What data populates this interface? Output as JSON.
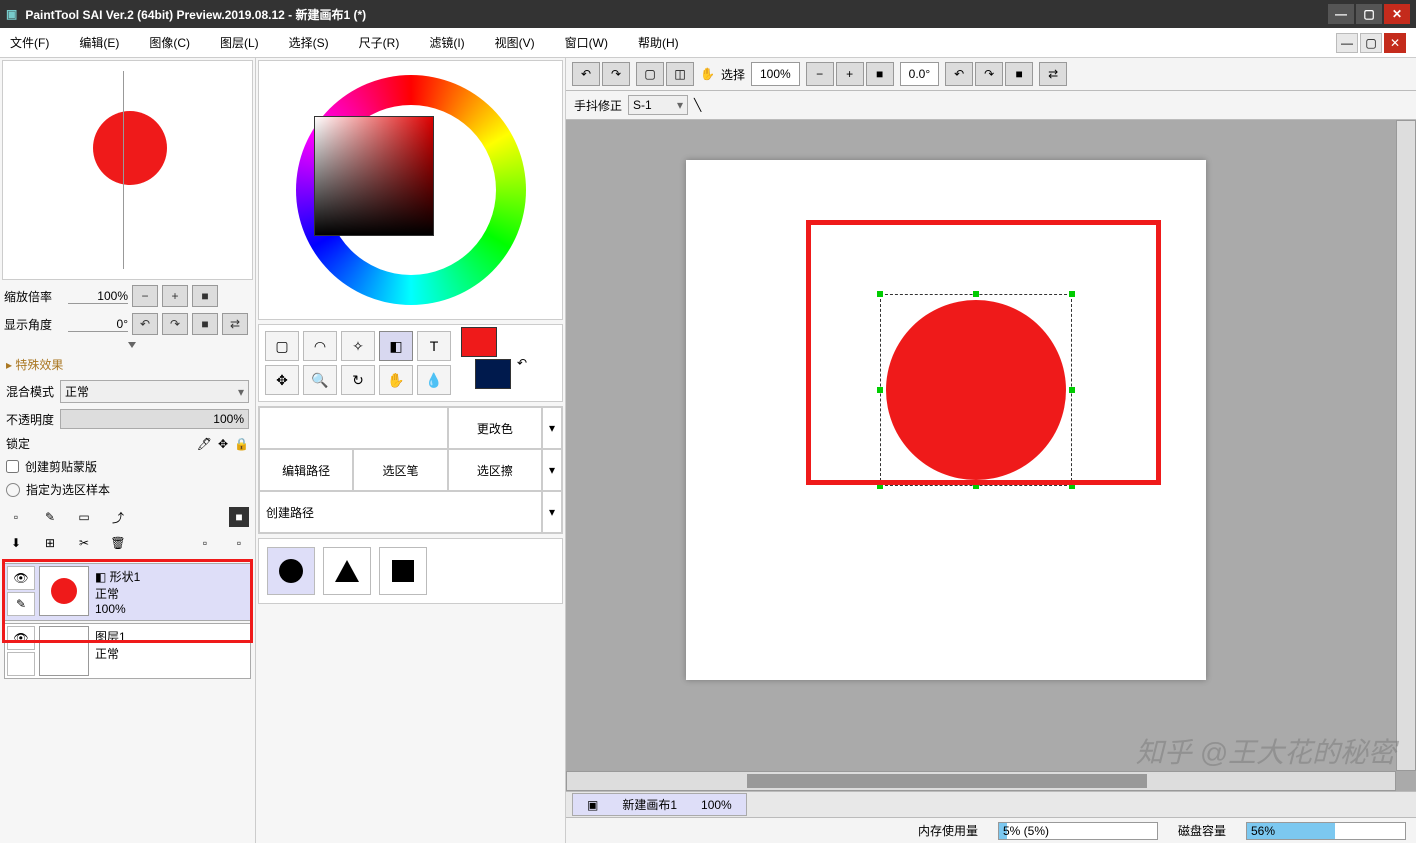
{
  "titlebar": {
    "title": "PaintTool SAI Ver.2 (64bit) Preview.2019.08.12 - 新建画布1 (*)"
  },
  "menu": [
    "文件(F)",
    "编辑(E)",
    "图像(C)",
    "图层(L)",
    "选择(S)",
    "尺子(R)",
    "滤镜(I)",
    "视图(V)",
    "窗口(W)",
    "帮助(H)"
  ],
  "nav": {
    "zoom_label": "缩放倍率",
    "zoom_value": "100%",
    "angle_label": "显示角度",
    "angle_value": "0°"
  },
  "effects_header": "▸ 特殊效果",
  "blend": {
    "label": "混合模式",
    "value": "正常"
  },
  "opacity": {
    "label": "不透明度",
    "value": "100%"
  },
  "lock_label": "锁定",
  "clipping_label": "创建剪贴蒙版",
  "select_sample_label": "指定为选区样本",
  "layers": [
    {
      "name": "形状1",
      "mode": "正常",
      "opacity": "100%"
    },
    {
      "name": "图层1",
      "mode": "正常"
    }
  ],
  "shape_opts": {
    "edit_path": "编辑路径",
    "sel_pen": "选区笔",
    "sel_erase": "选区擦",
    "create_path": "创建路径",
    "recolor": "更改色"
  },
  "swatch": {
    "fg": "#ef1a1a",
    "bg": "#001a4d"
  },
  "canvas_toolbar": {
    "select_label": "选择",
    "zoom": "100%",
    "angle": "0.0°"
  },
  "stabilizer": {
    "label": "手抖修正",
    "value": "S-1"
  },
  "tab": {
    "name": "新建画布1",
    "zoom": "100%"
  },
  "status": {
    "mem_label": "内存使用量",
    "mem_text": "5% (5%)",
    "mem_pct": 5,
    "disk_label": "磁盘容量",
    "disk_text": "56%",
    "disk_pct": 56
  },
  "watermark": "知乎 @王大花的秘密"
}
